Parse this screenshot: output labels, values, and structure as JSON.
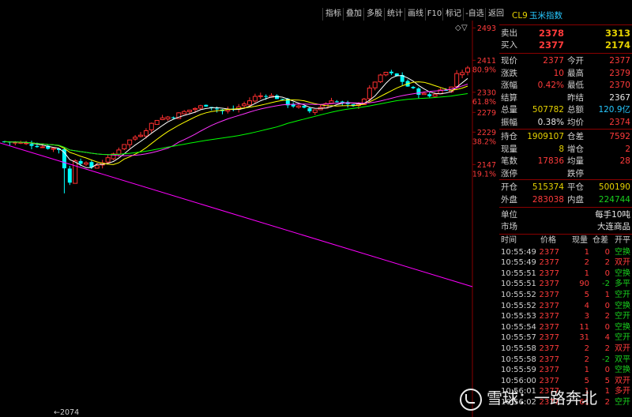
{
  "toolbar": {
    "buttons": [
      "指标",
      "叠加",
      "多股",
      "统计",
      "画线",
      "F10",
      "标记",
      "-自选",
      "返回"
    ]
  },
  "chart": {
    "price_labels": [
      {
        "price": "2493",
        "pct": ""
      },
      {
        "price": "2411",
        "pct": "80.9%"
      },
      {
        "price": "2330",
        "pct": "61.8%"
      },
      {
        "price": "2279",
        "pct": ""
      },
      {
        "price": "2229",
        "pct": "38.2%"
      },
      {
        "price": "2147",
        "pct": "19.1%"
      }
    ],
    "low_label": "←2074",
    "colors": {
      "ma5": "#ffffff",
      "ma10": "#ffff00",
      "ma20": "#ff33ff",
      "ma60": "#00ff00",
      "trend": "#ff00ff",
      "up": "#ff3030",
      "down": "#00ffff"
    }
  },
  "panel": {
    "code": "CL9",
    "name": "玉米指数",
    "ask": {
      "label": "卖出",
      "price": "2378",
      "vol": "3313"
    },
    "bid": {
      "label": "买入",
      "price": "2377",
      "vol": "2174"
    },
    "quote": [
      {
        "l1": "现价",
        "v1": "2377",
        "c1": "red",
        "l2": "今开",
        "v2": "2377",
        "c2": "red"
      },
      {
        "l1": "涨跌",
        "v1": "10",
        "c1": "red",
        "l2": "最高",
        "v2": "2379",
        "c2": "red"
      },
      {
        "l1": "涨幅",
        "v1": "0.42%",
        "c1": "red",
        "l2": "最低",
        "v2": "2370",
        "c2": "red"
      },
      {
        "l1": "结算",
        "v1": "",
        "c1": "white",
        "l2": "昨结",
        "v2": "2367",
        "c2": "white"
      },
      {
        "l1": "总量",
        "v1": "507782",
        "c1": "yellow",
        "l2": "总额",
        "v2": "120.9亿",
        "c2": "cyan"
      },
      {
        "l1": "振幅",
        "v1": "0.38%",
        "c1": "white",
        "l2": "均价",
        "v2": "2374",
        "c2": "red"
      }
    ],
    "position": [
      {
        "l1": "持仓",
        "v1": "1909107",
        "c1": "yellow",
        "l2": "仓差",
        "v2": "7592",
        "c2": "red"
      },
      {
        "l1": "现量",
        "v1": "8",
        "c1": "yellow",
        "l2": "增仓",
        "v2": "2",
        "c2": "red"
      },
      {
        "l1": "笔数",
        "v1": "17836",
        "c1": "red",
        "l2": "均量",
        "v2": "28",
        "c2": "red"
      },
      {
        "l1": "涨停",
        "v1": "",
        "c1": "white",
        "l2": "跌停",
        "v2": "",
        "c2": "white"
      }
    ],
    "flow": [
      {
        "l1": "开仓",
        "v1": "515374",
        "c1": "yellow",
        "l2": "平仓",
        "v2": "500190",
        "c2": "yellow"
      },
      {
        "l1": "外盘",
        "v1": "283038",
        "c1": "red",
        "l2": "内盘",
        "v2": "224744",
        "c2": "green"
      }
    ],
    "unit": {
      "label": "单位",
      "value": "每手10吨"
    },
    "market": {
      "label": "市场",
      "value": "大连商品"
    },
    "trade_headers": [
      "时间",
      "价格",
      "现量",
      "仓差",
      "开平"
    ],
    "trades": [
      {
        "t": "10:55:49",
        "p": "2377",
        "v": "1",
        "d": "0",
        "k": "空换",
        "kc": "green"
      },
      {
        "t": "10:55:49",
        "p": "2377",
        "v": "2",
        "d": "2",
        "k": "双开",
        "kc": "red"
      },
      {
        "t": "10:55:51",
        "p": "2377",
        "v": "1",
        "d": "0",
        "k": "空换",
        "kc": "green"
      },
      {
        "t": "10:55:51",
        "p": "2377",
        "v": "90",
        "d": "-2",
        "k": "多平",
        "kc": "green"
      },
      {
        "t": "10:55:52",
        "p": "2377",
        "v": "5",
        "d": "1",
        "k": "空开",
        "kc": "green"
      },
      {
        "t": "10:55:52",
        "p": "2377",
        "v": "4",
        "d": "0",
        "k": "空换",
        "kc": "green"
      },
      {
        "t": "10:55:53",
        "p": "2377",
        "v": "3",
        "d": "2",
        "k": "空开",
        "kc": "green"
      },
      {
        "t": "10:55:54",
        "p": "2377",
        "v": "11",
        "d": "0",
        "k": "空换",
        "kc": "green"
      },
      {
        "t": "10:55:57",
        "p": "2377",
        "v": "31",
        "d": "4",
        "k": "空开",
        "kc": "green"
      },
      {
        "t": "10:55:58",
        "p": "2377",
        "v": "2",
        "d": "2",
        "k": "双开",
        "kc": "red"
      },
      {
        "t": "10:55:58",
        "p": "2377",
        "v": "2",
        "d": "-2",
        "k": "双平",
        "kc": "green"
      },
      {
        "t": "10:55:59",
        "p": "2377",
        "v": "1",
        "d": "0",
        "k": "空换",
        "kc": "green"
      },
      {
        "t": "10:56:00",
        "p": "2377",
        "v": "5",
        "d": "5",
        "k": "双开",
        "kc": "red"
      },
      {
        "t": "10:56:01",
        "p": "2377",
        "v": "1",
        "d": "1",
        "k": "多开",
        "kc": "red"
      },
      {
        "t": "10:56:02",
        "p": "2377",
        "v": "61",
        "d": "2",
        "k": "空开",
        "kc": "green"
      }
    ]
  },
  "watermark": "雪球：一路奔北"
}
